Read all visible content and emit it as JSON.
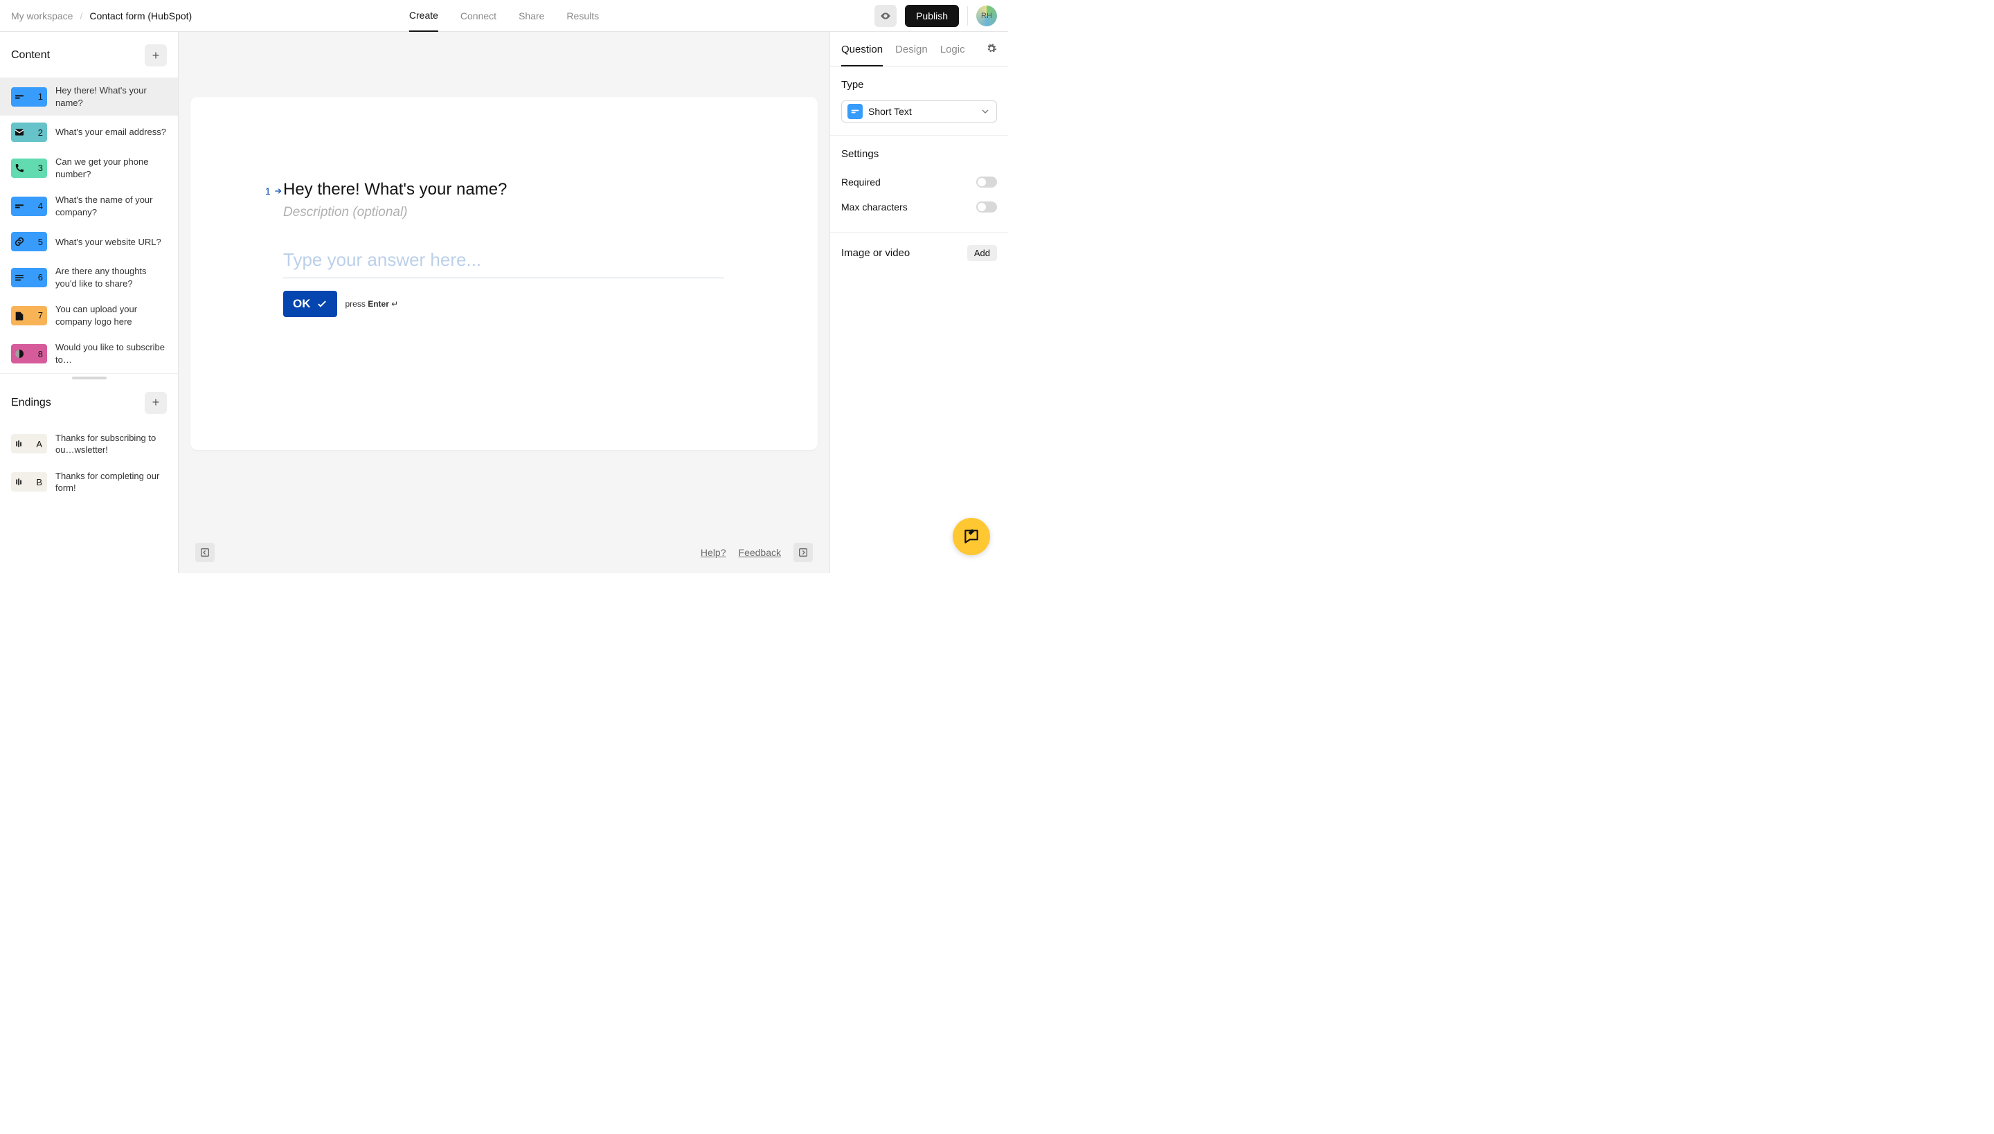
{
  "breadcrumb": {
    "workspace": "My workspace",
    "title": "Contact form (HubSpot)"
  },
  "topnav": {
    "create": "Create",
    "connect": "Connect",
    "share": "Share",
    "results": "Results"
  },
  "topright": {
    "publish": "Publish",
    "avatar": "RH"
  },
  "left": {
    "content_header": "Content",
    "endings_header": "Endings",
    "questions": [
      {
        "n": "1",
        "label": "Hey there! What's your name?",
        "color": "#379cfb",
        "icon": "short-text"
      },
      {
        "n": "2",
        "label": "What's your email address?",
        "color": "#65c3c9",
        "icon": "email"
      },
      {
        "n": "3",
        "label": "Can we get your phone number?",
        "color": "#62dbb1",
        "icon": "phone"
      },
      {
        "n": "4",
        "label": "What's the name of your company?",
        "color": "#379cfb",
        "icon": "short-text"
      },
      {
        "n": "5",
        "label": "What's your website URL?",
        "color": "#379cfb",
        "icon": "link"
      },
      {
        "n": "6",
        "label": "Are there any thoughts you'd like to share?",
        "color": "#379cfb",
        "icon": "long-text"
      },
      {
        "n": "7",
        "label": "You can upload your company logo here",
        "color": "#f8b356",
        "icon": "file"
      },
      {
        "n": "8",
        "label": "Would you like to subscribe to…",
        "color": "#d65b9b",
        "icon": "yes-no"
      }
    ],
    "endings": [
      {
        "n": "A",
        "label": "Thanks for subscribing to ou…wsletter!"
      },
      {
        "n": "B",
        "label": "Thanks for completing our form!"
      }
    ]
  },
  "canvas": {
    "number": "1",
    "title": "Hey there! What's your name?",
    "description_placeholder": "Description (optional)",
    "answer_placeholder": "Type your answer here...",
    "ok": "OK",
    "hint_press": "press ",
    "hint_enter": "Enter",
    "hint_arrow": " ↵"
  },
  "footer": {
    "help": "Help?",
    "feedback": "Feedback"
  },
  "right": {
    "tabs": {
      "question": "Question",
      "design": "Design",
      "logic": "Logic"
    },
    "type_label": "Type",
    "type_value": "Short Text",
    "settings_label": "Settings",
    "required": "Required",
    "maxchars": "Max characters",
    "media_label": "Image or video",
    "add": "Add"
  }
}
